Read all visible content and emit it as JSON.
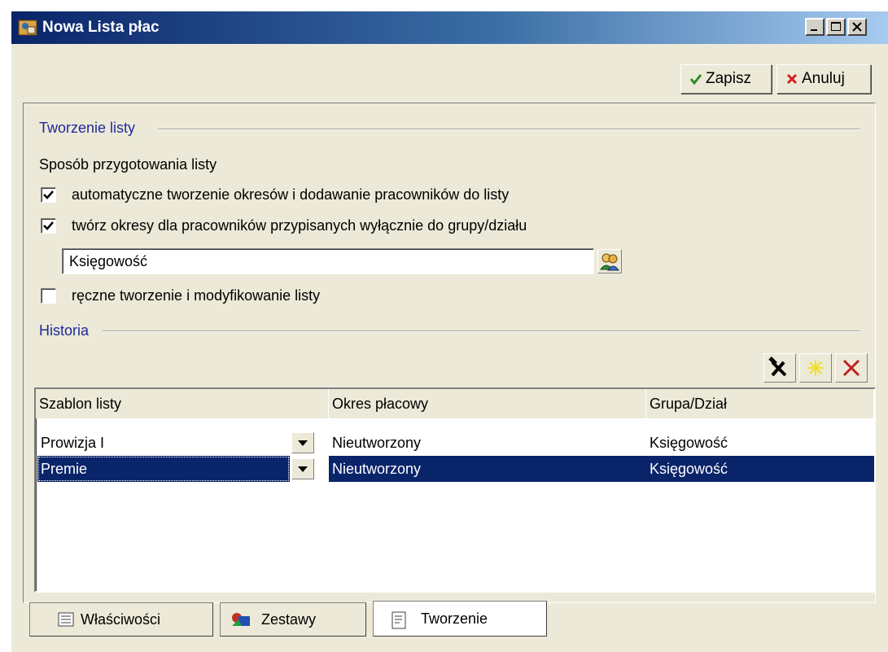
{
  "window": {
    "title": "Nowa Lista płac"
  },
  "toolbar": {
    "save_label": "Zapisz",
    "cancel_label": "Anuluj"
  },
  "creation": {
    "group_title": "Tworzenie listy",
    "mode_label": "Sposób przygotowania listy",
    "options": [
      {
        "label": "automatyczne tworzenie okresów i dodawanie pracowników do listy",
        "checked": true
      },
      {
        "label": "twórz okresy dla pracowników przypisanych wyłącznie do grupy/działu",
        "checked": true
      },
      {
        "label": "ręczne tworzenie i modyfikowanie listy",
        "checked": false
      }
    ],
    "group_value": "Księgowość"
  },
  "history": {
    "group_title": "Historia",
    "columns": [
      "Szablon listy",
      "Okres płacowy",
      "Grupa/Dział"
    ],
    "rows": [
      {
        "template": "Prowizja I",
        "period": "Nieutworzony",
        "group": "Księgowość",
        "selected": false
      },
      {
        "template": "Premie",
        "period": "Nieutworzony",
        "group": "Księgowość",
        "selected": true
      }
    ]
  },
  "tabs": [
    {
      "label": "Właściwości",
      "icon": "properties-icon",
      "active": false
    },
    {
      "label": "Zestawy",
      "icon": "sets-icon",
      "active": false
    },
    {
      "label": "Tworzenie",
      "icon": "document-icon",
      "active": true
    }
  ],
  "colors": {
    "titlebar_start": "#0a246a",
    "selection": "#0a246a",
    "group_title": "#1f2a9a",
    "dialog_bg": "#ece9d8"
  }
}
